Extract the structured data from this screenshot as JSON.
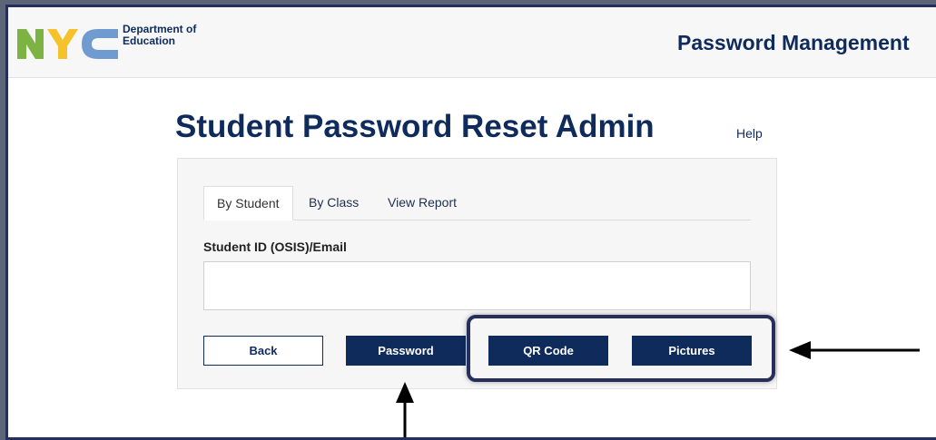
{
  "header": {
    "org_line1": "Department of",
    "org_line2": "Education",
    "app_title": "Password Management"
  },
  "page": {
    "title": "Student Password Reset Admin",
    "help_label": "Help"
  },
  "tabs": [
    {
      "label": "By Student",
      "active": true
    },
    {
      "label": "By Class",
      "active": false
    },
    {
      "label": "View Report",
      "active": false
    }
  ],
  "form": {
    "field_label": "Student ID (OSIS)/Email",
    "field_value": ""
  },
  "buttons": {
    "back": "Back",
    "password": "Password",
    "qr_code": "QR Code",
    "pictures": "Pictures"
  },
  "colors": {
    "brand_navy": "#0e2b5c",
    "logo_green": "#7cb342",
    "logo_yellow": "#f6c22c",
    "logo_blue": "#6f9bd1",
    "annotation": "#262f5c"
  },
  "icons": {
    "logo": "nyc-logo",
    "arrow_left": "arrow-left-icon",
    "arrow_up": "arrow-up-icon"
  }
}
